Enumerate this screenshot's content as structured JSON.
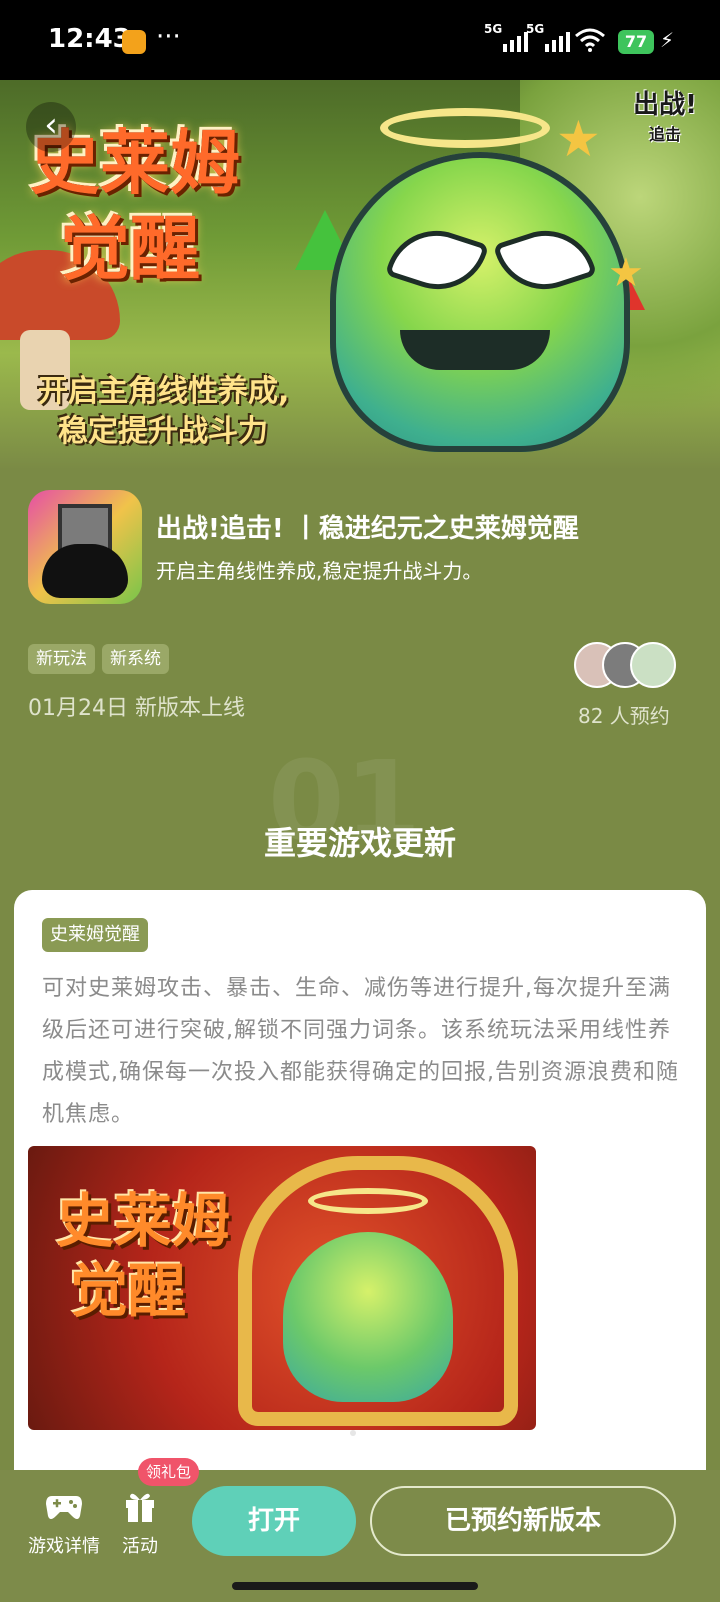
{
  "status_bar": {
    "time": "12:43",
    "more": "···",
    "signal1": "5G",
    "signal2": "5G",
    "battery": "77"
  },
  "banner": {
    "title_art": "史莱姆\n觉醒",
    "title_line1": "史莱姆",
    "title_line2": "觉醒",
    "slogan_line1": "开启主角线性养成,",
    "slogan_line2": "稳定提升战斗力",
    "logo_line1": "出战!",
    "logo_line2": "追击"
  },
  "game": {
    "title": "出战!追击! 丨稳进纪元之史莱姆觉醒",
    "subtitle": "开启主角线性养成,稳定提升战斗力。",
    "tags": [
      "新玩法",
      "新系统"
    ],
    "date": "01月24日 新版本上线",
    "reserve_count": "82 人预约"
  },
  "section": {
    "number": "01",
    "title": "重要游戏更新"
  },
  "card": {
    "tag": "史莱姆觉醒",
    "description": "可对史莱姆攻击、暴击、生命、减伤等进行提升,每次提升至满级后还可进行突破,解锁不同强力词条。该系统玩法采用线性养成模式,确保每一次投入都能获得确定的回报,告别资源浪费和随机焦虑。",
    "art_title_line1": "史莱姆",
    "art_title_line2": "觉醒"
  },
  "bottom_bar": {
    "game_details": "游戏详情",
    "activity": "活动",
    "gift_badge": "领礼包",
    "open": "打开",
    "reserved": "已预约新版本"
  },
  "colors": {
    "page_bg": "#7a8a45",
    "open_button": "#5fd0b8",
    "badge": "#f0546a",
    "tag_bg": "#8a9a54"
  }
}
